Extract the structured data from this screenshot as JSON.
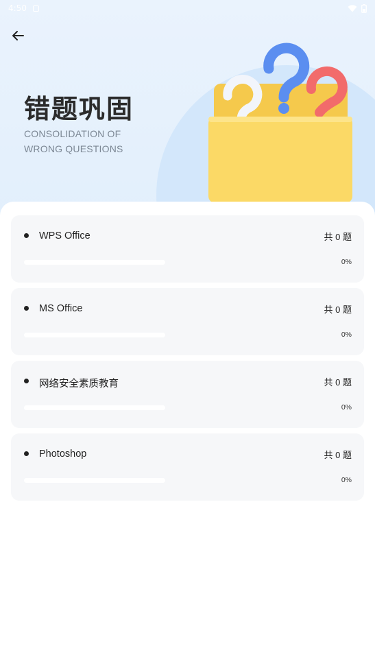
{
  "status_bar": {
    "time": "4:50",
    "icons": [
      "notification-icon",
      "wifi-icon",
      "battery-icon"
    ]
  },
  "header": {
    "back_icon": "arrow-left-icon",
    "title": "错题巩固",
    "subtitle": "CONSOLIDATION OF WRONG QUESTIONS",
    "illustration": "folder-with-question-marks"
  },
  "colors": {
    "hero_background": "#e2effc",
    "card_background": "#f6f7f9",
    "progress_track": "#ffffff",
    "text_primary": "#222222"
  },
  "subjects": [
    {
      "title": "WPS Office",
      "count": "共 0 题",
      "percent_label": "0%",
      "progress": 0
    },
    {
      "title": "MS Office",
      "count": "共 0 题",
      "percent_label": "0%",
      "progress": 0
    },
    {
      "title": "网络安全素质教育",
      "count": "共 0 题",
      "percent_label": "0%",
      "progress": 0
    },
    {
      "title": "Photoshop",
      "count": "共 0 题",
      "percent_label": "0%",
      "progress": 0
    }
  ]
}
